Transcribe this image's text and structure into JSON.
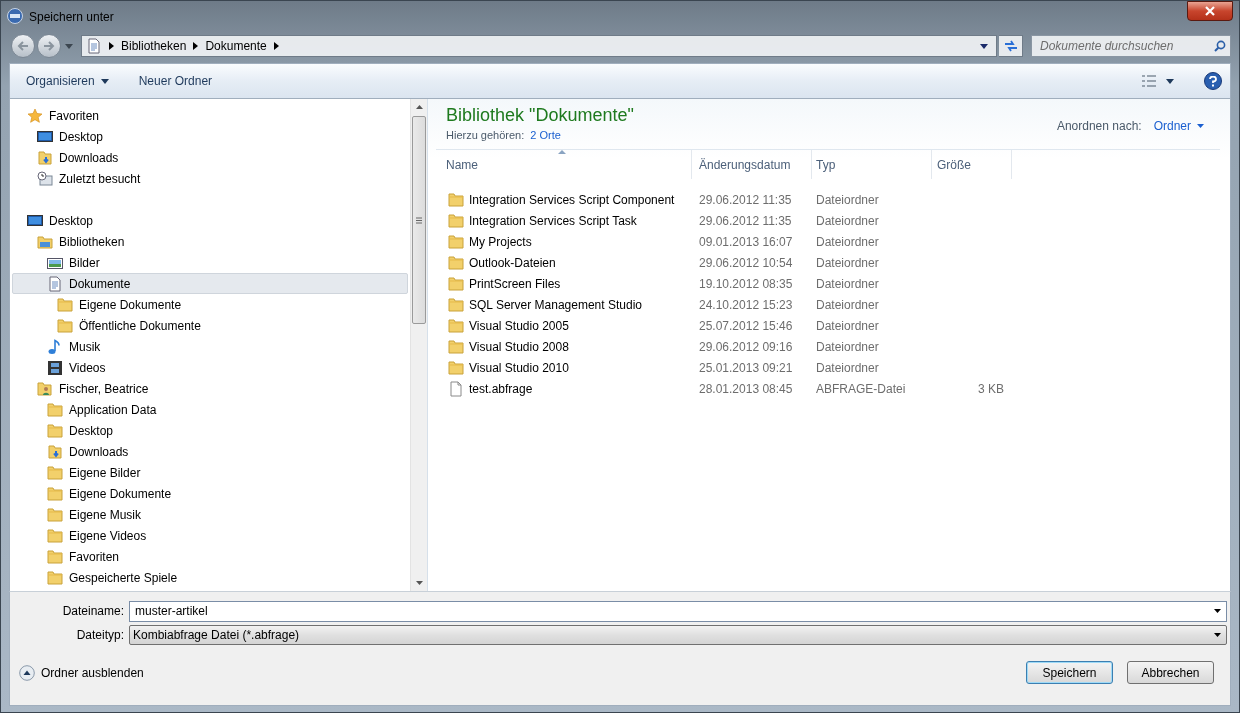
{
  "window": {
    "title": "Speichern unter"
  },
  "address": {
    "crumbs": [
      "Bibliotheken",
      "Dokumente"
    ]
  },
  "search": {
    "placeholder": "Dokumente durchsuchen"
  },
  "toolbar": {
    "buttons": [
      {
        "label": "Organisieren",
        "dropdown": true
      },
      {
        "label": "Neuer Ordner",
        "dropdown": false
      }
    ]
  },
  "nav": [
    {
      "label": "Favoriten",
      "kind": "star",
      "selected": false,
      "children": [
        {
          "label": "Desktop",
          "kind": "desktop",
          "selected": false
        },
        {
          "label": "Downloads",
          "kind": "downloads",
          "selected": false
        },
        {
          "label": "Zuletzt besucht",
          "kind": "recent",
          "selected": false
        }
      ]
    },
    {
      "label": "Desktop",
      "kind": "desktop",
      "selected": false,
      "children": [
        {
          "label": "Bibliotheken",
          "kind": "library",
          "selected": false,
          "children": [
            {
              "label": "Bilder",
              "kind": "pictures",
              "selected": false
            },
            {
              "label": "Dokumente",
              "kind": "document",
              "selected": true,
              "children": [
                {
                  "label": "Eigene Dokumente",
                  "kind": "folder",
                  "selected": false
                },
                {
                  "label": "Öffentliche Dokumente",
                  "kind": "folder",
                  "selected": false
                }
              ]
            },
            {
              "label": "Musik",
              "kind": "music",
              "selected": false
            },
            {
              "label": "Videos",
              "kind": "video",
              "selected": false
            }
          ]
        },
        {
          "label": "Fischer, Beatrice",
          "kind": "user",
          "selected": false,
          "children": [
            {
              "label": "Application Data",
              "kind": "folder",
              "selected": false
            },
            {
              "label": "Desktop",
              "kind": "folder",
              "selected": false
            },
            {
              "label": "Downloads",
              "kind": "downloads",
              "selected": false
            },
            {
              "label": "Eigene Bilder",
              "kind": "folder",
              "selected": false
            },
            {
              "label": "Eigene Dokumente",
              "kind": "folder",
              "selected": false
            },
            {
              "label": "Eigene Musik",
              "kind": "folder",
              "selected": false
            },
            {
              "label": "Eigene Videos",
              "kind": "folder",
              "selected": false
            },
            {
              "label": "Favoriten",
              "kind": "folder",
              "selected": false
            },
            {
              "label": "Gespeicherte Spiele",
              "kind": "folder",
              "selected": false
            }
          ]
        }
      ]
    }
  ],
  "library": {
    "title": "Bibliothek \"Dokumente\"",
    "includes_label": "Hierzu gehören:",
    "includes_link": "2 Orte",
    "arrange_label": "Anordnen nach:",
    "arrange_value": "Ordner"
  },
  "table": {
    "columns": [
      "Name",
      "Änderungsdatum",
      "Typ",
      "Größe"
    ],
    "rows": [
      {
        "kind": "folder",
        "name": "Integration Services Script Component",
        "date": "29.06.2012 11:35",
        "type": "Dateiordner"
      },
      {
        "kind": "folder",
        "name": "Integration Services Script Task",
        "date": "29.06.2012 11:35",
        "type": "Dateiordner"
      },
      {
        "kind": "folder",
        "name": "My Projects",
        "date": "09.01.2013 16:07",
        "type": "Dateiordner"
      },
      {
        "kind": "folder",
        "name": "Outlook-Dateien",
        "date": "29.06.2012 10:54",
        "type": "Dateiordner"
      },
      {
        "kind": "folder",
        "name": "PrintScreen Files",
        "date": "19.10.2012 08:35",
        "type": "Dateiordner"
      },
      {
        "kind": "folder",
        "name": "SQL Server Management Studio",
        "date": "24.10.2012 15:23",
        "type": "Dateiordner"
      },
      {
        "kind": "folder",
        "name": "Visual Studio 2005",
        "date": "25.07.2012 15:46",
        "type": "Dateiordner"
      },
      {
        "kind": "folder",
        "name": "Visual Studio 2008",
        "date": "29.06.2012 09:16",
        "type": "Dateiordner"
      },
      {
        "kind": "folder",
        "name": "Visual Studio 2010",
        "date": "25.01.2013 09:21",
        "type": "Dateiordner"
      },
      {
        "kind": "file",
        "name": "test.abfrage",
        "date": "28.01.2013 08:45",
        "type": "ABFRAGE-Datei",
        "size": "3 KB"
      }
    ]
  },
  "filename": {
    "label": "Dateiname:",
    "value": "muster-artikel"
  },
  "filetype": {
    "label": "Dateityp:",
    "value": "Kombiabfrage Datei (*.abfrage)"
  },
  "hide_folders": "Ordner ausblenden",
  "buttons": [
    {
      "label": "Speichern",
      "default": true
    },
    {
      "label": "Abbrechen",
      "default": false
    }
  ]
}
